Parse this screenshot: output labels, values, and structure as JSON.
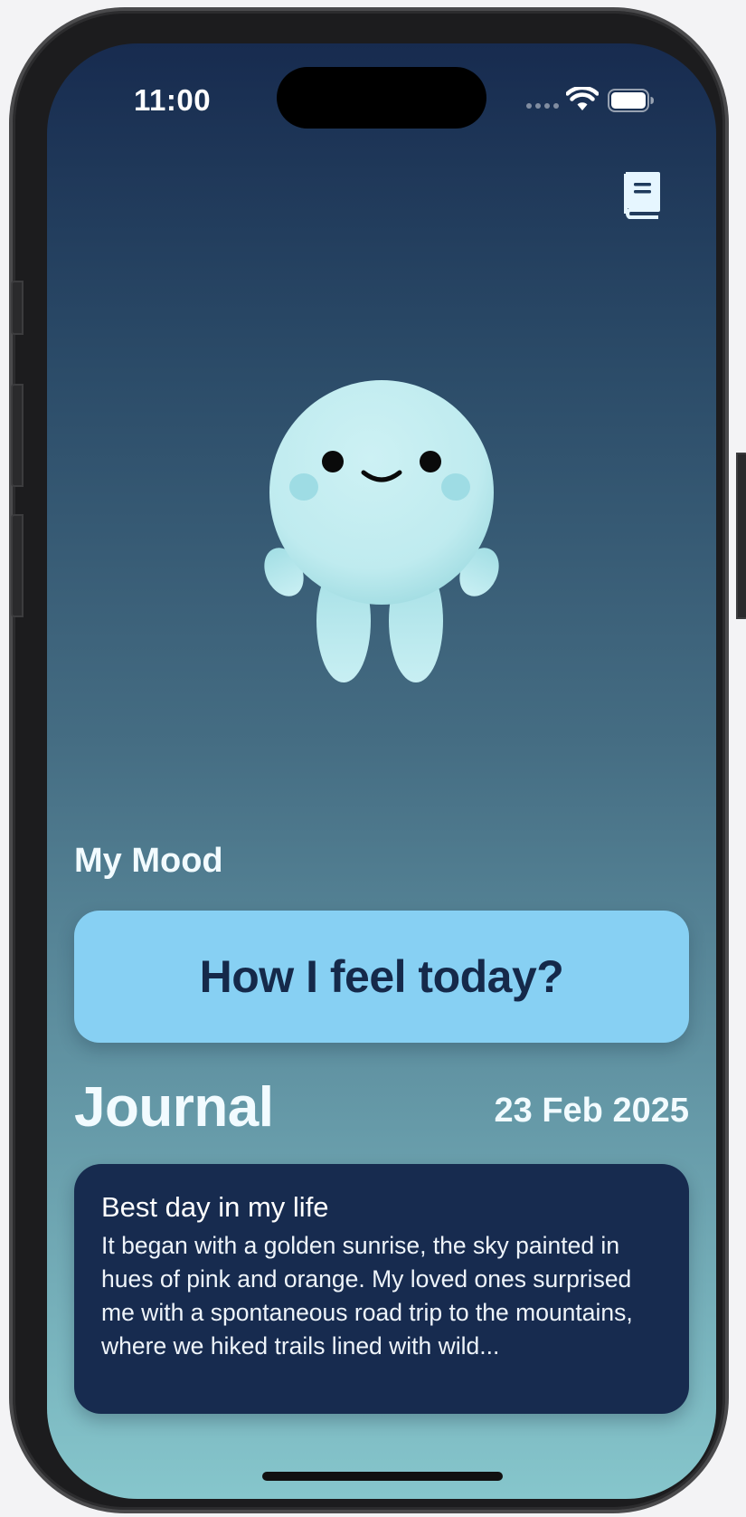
{
  "status_bar": {
    "time": "11:00"
  },
  "toolbar": {
    "journal_icon": "book-icon"
  },
  "mascot": {
    "icon": "smiling-mascot"
  },
  "mood": {
    "section_title": "My Mood",
    "button_label": "How I feel today?"
  },
  "journal": {
    "heading": "Journal",
    "date": "23 Feb 2025",
    "entry": {
      "title": "Best day in my life",
      "body": "It began with a golden sunrise, the sky painted in hues of pink and orange. My loved ones surprised me with a spontaneous road trip to the mountains, where we hiked trails lined with wild..."
    }
  },
  "colors": {
    "gradient_top": "#172b4f",
    "gradient_bottom": "#86c6cc",
    "button_bg": "#87d0f3",
    "card_bg": "#172b4f",
    "text_dark": "#15294a"
  }
}
